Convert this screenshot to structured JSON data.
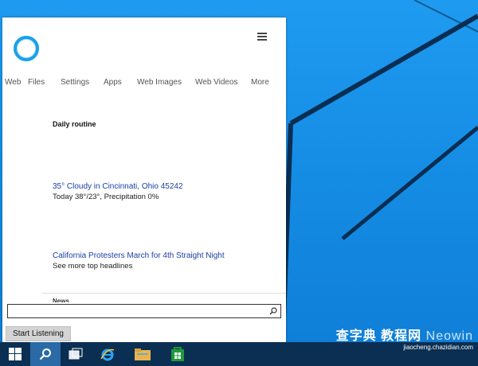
{
  "cortana": {
    "nav": [
      "Web",
      "Files",
      "Settings",
      "Apps",
      "Web Images",
      "Web Videos",
      "More"
    ],
    "section_title": "Daily routine",
    "weather": {
      "headline": "35° Cloudy in Cincinnati, Ohio 45242",
      "detail": "Today 38°/23°, Precipitation 0%"
    },
    "news": {
      "headline": "California Protesters March for 4th Straight Night",
      "detail": "See more top headlines",
      "peek_label": "News"
    },
    "search": {
      "value": "",
      "placeholder": ""
    },
    "start_listening": "Start Listening"
  },
  "taskbar": {
    "icons": [
      "windows-start-icon",
      "search-icon",
      "task-view-icon",
      "internet-explorer-icon",
      "file-explorer-icon",
      "store-icon"
    ]
  },
  "watermark": {
    "main": "查字典 教程网",
    "brand": "Neowin",
    "url": "jiaocheng.chazidian.com"
  },
  "colors": {
    "desktop": "#168ee6",
    "taskbar": "#0b2f52",
    "cortana_accent": "#1aa1e8",
    "link": "#1c3ea6"
  }
}
